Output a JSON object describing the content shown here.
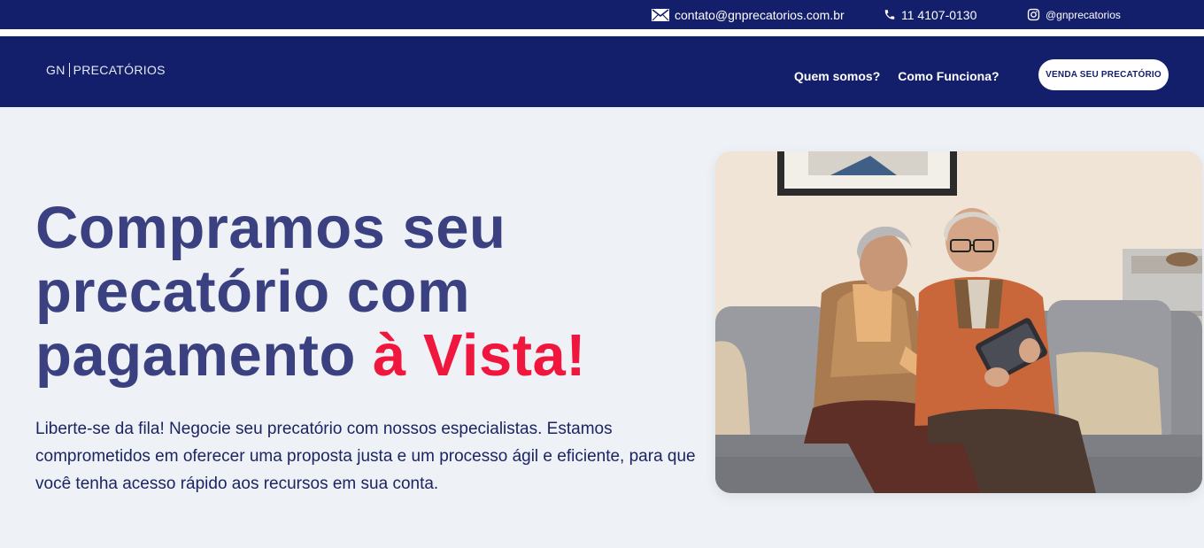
{
  "topbar": {
    "email": "contato@gnprecatorios.com.br",
    "email_icon": "envelope-icon",
    "phone": "11 4107-0130",
    "phone_icon": "phone-icon",
    "instagram": "@gnprecatorios",
    "instagram_icon": "instagram-icon"
  },
  "nav": {
    "logo_left": "GN",
    "logo_right": "PRECATÓRIOS",
    "links": [
      "Quem somos?",
      "Como Funciona?"
    ],
    "cta": "VENDA SEU PRECATÓRIO"
  },
  "hero": {
    "title_line1": "Compramos seu",
    "title_line2": "precatório com",
    "title_line3_main": "pagamento ",
    "title_line3_accent": "à Vista!",
    "description": "Liberte-se da fila! Negocie seu precatório com nossos especialistas. Estamos comprometidos em oferecer uma proposta justa e um processo ágil e eficiente, para que você tenha acesso rápido aos recursos em sua conta."
  },
  "colors": {
    "brand_navy": "#131f6b",
    "title_text": "#3b4180",
    "accent_red": "#f0173e",
    "background": "#eef2f7"
  }
}
